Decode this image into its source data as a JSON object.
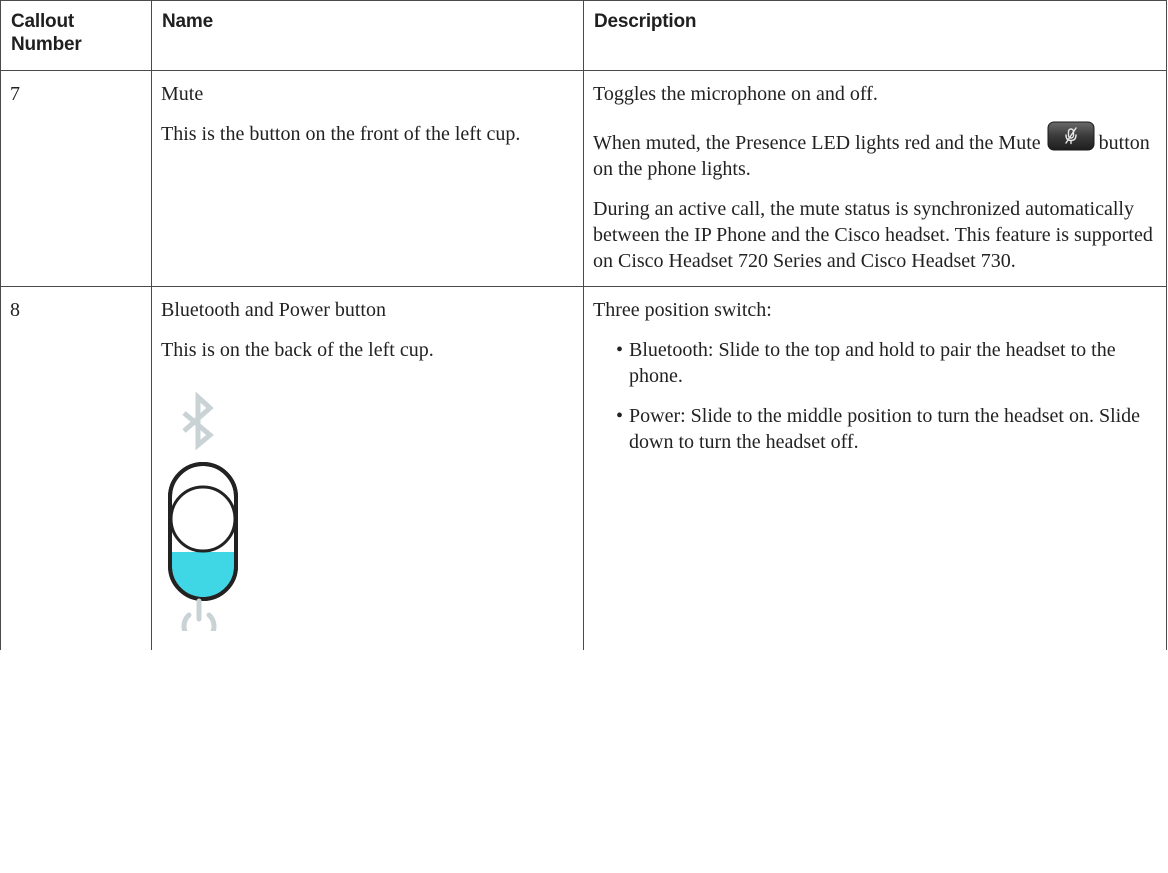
{
  "table": {
    "headers": {
      "callout": "Callout Number",
      "name": "Name",
      "description": "Description"
    },
    "rows": [
      {
        "number": "7",
        "name": "Mute",
        "name_note": "This is the button on the front of the left cup.",
        "desc_p1": "Toggles the microphone on and off.",
        "desc_p2_before": "When muted, the Presence LED lights red and the Mute",
        "desc_p2_after": "button on the phone lights.",
        "desc_p3": "During an active call, the mute status is synchronized automatically between the IP Phone and the Cisco headset. This feature is supported on Cisco Headset 720 Series and Cisco Headset 730."
      },
      {
        "number": "8",
        "name": "Bluetooth and Power button",
        "name_note": "This is on the back of the left cup.",
        "desc_intro": "Three position switch:",
        "desc_bullets": [
          "Bluetooth: Slide to the top and hold to pair the headset to the phone.",
          "Power: Slide to the middle position to turn the headset on. Slide down to turn the headset off."
        ]
      }
    ]
  },
  "icons": {
    "mute_key": "mute-key-icon",
    "bluetooth": "bluetooth-icon",
    "switch": "three-position-switch-icon",
    "power": "power-icon"
  },
  "colors": {
    "switch_fill": "#3fd6e6",
    "icon_grey": "#c9d3d6",
    "border": "#4a4a4a"
  }
}
